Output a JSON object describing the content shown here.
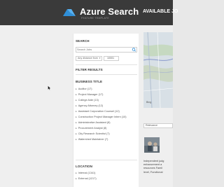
{
  "header": {
    "brand": "Azure Search",
    "brand_sub": "FEATURE TEMPLATE",
    "nav_link": "AVAILABLE JO"
  },
  "sidebar": {
    "search_title": "SEARCH",
    "search_placeholder": "Search Jobs",
    "distance_label": "Any distance from",
    "zip_value": "10001",
    "filter_title": "FILTER RESULTS",
    "business_title": "BUSINESS TITLE",
    "business_items": [
      "Auditor (17)",
      "Project Manager (17)",
      "College Aide (13)",
      "Agency Attorney (12)",
      "Assistant Corporation Counsel (12)",
      "Construction Project Manager Intern (10)",
      "Administrative Assistant (8)",
      "Procurement Analyst (8)",
      "City Research Scientist (7)",
      "Watershed Maintainer (7)"
    ],
    "location_title": "LOCATION",
    "location_items": [
      "Internal (1341)",
      "External (1217)"
    ]
  },
  "main": {
    "map_attribution": "Bing",
    "sort_value": "Relevance",
    "job_desc_lines": [
      "Independent judg",
      "enhancement a",
      "resources Famil",
      "level, Functional"
    ]
  },
  "colors": {
    "header_bg": "#3a3a3a",
    "accent_blue": "#2f8fd8",
    "page_bg": "#efefef"
  },
  "icons": [
    "azure-search-logo-icon",
    "search-icon",
    "caret-right-icon",
    "mouse-cursor-icon"
  ]
}
